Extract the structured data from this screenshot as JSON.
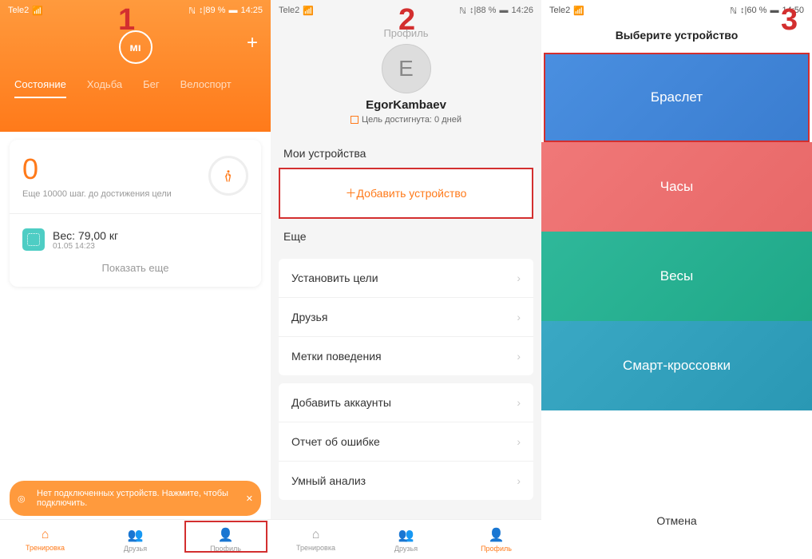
{
  "screen1": {
    "statusbar": {
      "carrier": "Tele2",
      "nfc": "89 %",
      "time": "14:25"
    },
    "step_label": "1",
    "logo": "ᴍı",
    "tabs": [
      "Состояние",
      "Ходьба",
      "Бег",
      "Велоспорт"
    ],
    "steps": "0",
    "steps_sub": "Еще 10000 шаг. до достижения цели",
    "weight_label": "Вес: 79,00  кг",
    "weight_date": "01.05 14:23",
    "show_more": "Показать еще",
    "toast": "Нет подключенных устройств. Нажмите, чтобы подключить.",
    "nav": [
      "Тренировка",
      "Друзья",
      "Профиль"
    ]
  },
  "screen2": {
    "statusbar": {
      "carrier": "Tele2",
      "nfc": "88 %",
      "time": "14:26"
    },
    "step_label": "2",
    "title": "Профиль",
    "avatar_letter": "E",
    "username": "EgorKambaev",
    "goal": "Цель достигнута: 0 дней",
    "devices_header": "Мои устройства",
    "add_device": "Добавить устройство",
    "more_header": "Еще",
    "list_a": [
      "Установить цели",
      "Друзья",
      "Метки поведения"
    ],
    "list_b": [
      "Добавить аккаунты",
      "Отчет об ошибке",
      "Умный анализ"
    ],
    "nav": [
      "Тренировка",
      "Друзья",
      "Профиль"
    ]
  },
  "screen3": {
    "statusbar": {
      "carrier": "Tele2",
      "nfc": "60 %",
      "time": "14:50"
    },
    "step_label": "3",
    "title": "Выберите устройство",
    "tiles": [
      "Браслет",
      "Часы",
      "Весы",
      "Смарт-кроссовки"
    ],
    "cancel": "Отмена"
  }
}
